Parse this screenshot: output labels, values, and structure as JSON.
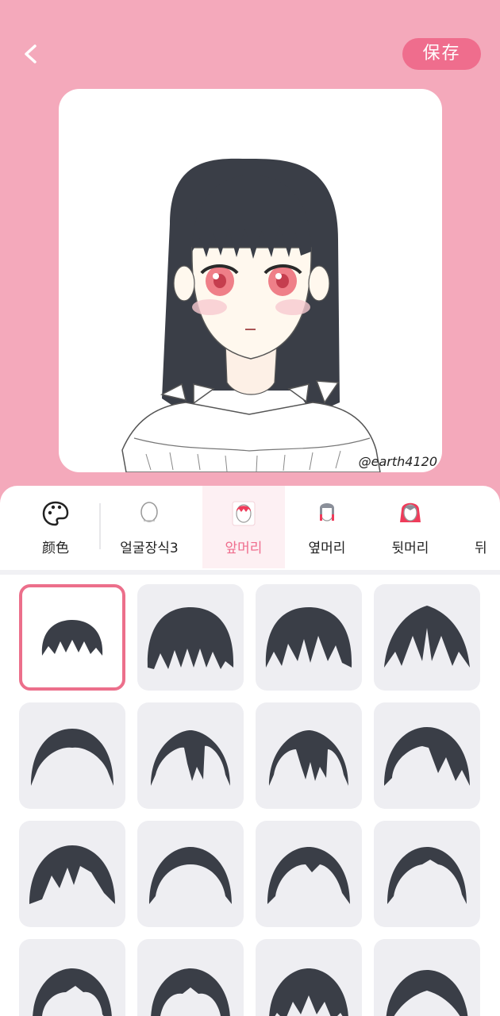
{
  "header": {
    "back_icon": "chevron-left-icon",
    "save_label": "保存"
  },
  "preview": {
    "watermark": "@earth4120"
  },
  "tabs": [
    {
      "label": "颜色",
      "icon": "palette-icon",
      "active": false
    },
    {
      "label": "얼굴장식3",
      "icon": "face-decoration-icon",
      "active": false
    },
    {
      "label": "앞머리",
      "icon": "bangs-icon",
      "active": true
    },
    {
      "label": "옆머리",
      "icon": "side-hair-icon",
      "active": false
    },
    {
      "label": "뒷머리",
      "icon": "back-hair-icon",
      "active": false
    },
    {
      "label": "뒤",
      "icon": "",
      "active": false
    }
  ],
  "options": {
    "selected_index": 0,
    "count_visible": 16
  },
  "colors": {
    "background": "#f4a9bb",
    "accent": "#ef6d8d",
    "hair": "#3a3e47"
  }
}
